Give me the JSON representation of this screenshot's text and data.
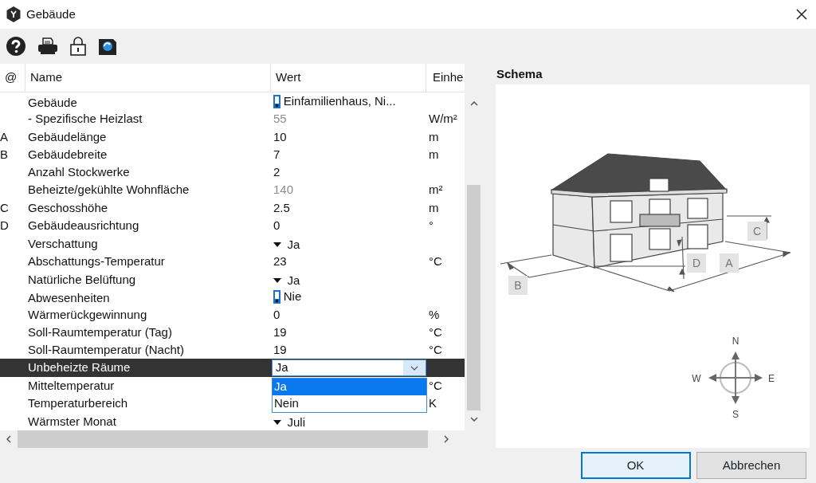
{
  "window": {
    "title": "Gebäude"
  },
  "table": {
    "columns": [
      "@",
      "Name",
      "Wert",
      "Einhe"
    ],
    "rows": [
      {
        "name": "Gebäude",
        "value": "Einfamilienhaus, Ni...",
        "kind": "icon",
        "selected": false
      },
      {
        "name": "- Spezifische Heizlast",
        "value": "55",
        "kind": "computed",
        "unit": "W/m²",
        "selected": false
      },
      {
        "marker": "A",
        "name": "Gebäudelänge",
        "value": "10",
        "kind": "plain",
        "unit": "m",
        "selected": false
      },
      {
        "marker": "B",
        "name": "Gebäudebreite",
        "value": "7",
        "kind": "plain",
        "unit": "m",
        "selected": false
      },
      {
        "name": "Anzahl Stockwerke",
        "value": "2",
        "kind": "plain",
        "selected": false
      },
      {
        "name": "Beheizte/gekühlte Wohnfläche",
        "value": "140",
        "kind": "computed",
        "unit": "m²",
        "selected": false
      },
      {
        "marker": "C",
        "name": "Geschosshöhe",
        "value": "2.5",
        "kind": "plain",
        "unit": "m",
        "selected": false
      },
      {
        "marker": "D",
        "name": "Gebäudeausrichtung",
        "value": "0",
        "kind": "plain",
        "unit": "°",
        "selected": false
      },
      {
        "name": "Verschattung",
        "value": "Ja",
        "kind": "choice",
        "selected": false
      },
      {
        "name": "Abschattungs-Temperatur",
        "value": "23",
        "kind": "plain",
        "unit": "°C",
        "selected": false
      },
      {
        "name": "Natürliche Belüftung",
        "value": "Ja",
        "kind": "choice",
        "selected": false
      },
      {
        "name": "Abwesenheiten",
        "value": "Nie",
        "kind": "icon",
        "selected": false
      },
      {
        "name": "Wärmerückgewinnung",
        "value": "0",
        "kind": "plain",
        "unit": "%",
        "selected": false
      },
      {
        "name": "Soll-Raumtemperatur (Tag)",
        "value": "19",
        "kind": "plain",
        "unit": "°C",
        "selected": false
      },
      {
        "name": "Soll-Raumtemperatur (Nacht)",
        "value": "19",
        "kind": "plain",
        "unit": "°C",
        "selected": false
      },
      {
        "name": "Unbeheizte Räume",
        "value": "Ja",
        "kind": "combo",
        "selected": true,
        "options": [
          {
            "label": "Ja",
            "selected": true
          },
          {
            "label": "Nein",
            "selected": false
          }
        ]
      },
      {
        "name": "Mitteltemperatur",
        "kind": "hidden",
        "unit": "°C",
        "selected": false
      },
      {
        "name": "Temperaturbereich",
        "kind": "hidden",
        "unit": "K",
        "selected": false
      },
      {
        "name": "Wärmster Monat",
        "value": "Juli",
        "kind": "choice",
        "selected": false
      }
    ]
  },
  "schema": {
    "title": "Schema",
    "dimension_labels": [
      "A",
      "B",
      "C",
      "D"
    ],
    "compass": [
      "N",
      "E",
      "S",
      "W"
    ]
  },
  "buttons": [
    {
      "label": "OK",
      "default": true
    },
    {
      "label": "Abbrechen",
      "default": false
    }
  ]
}
